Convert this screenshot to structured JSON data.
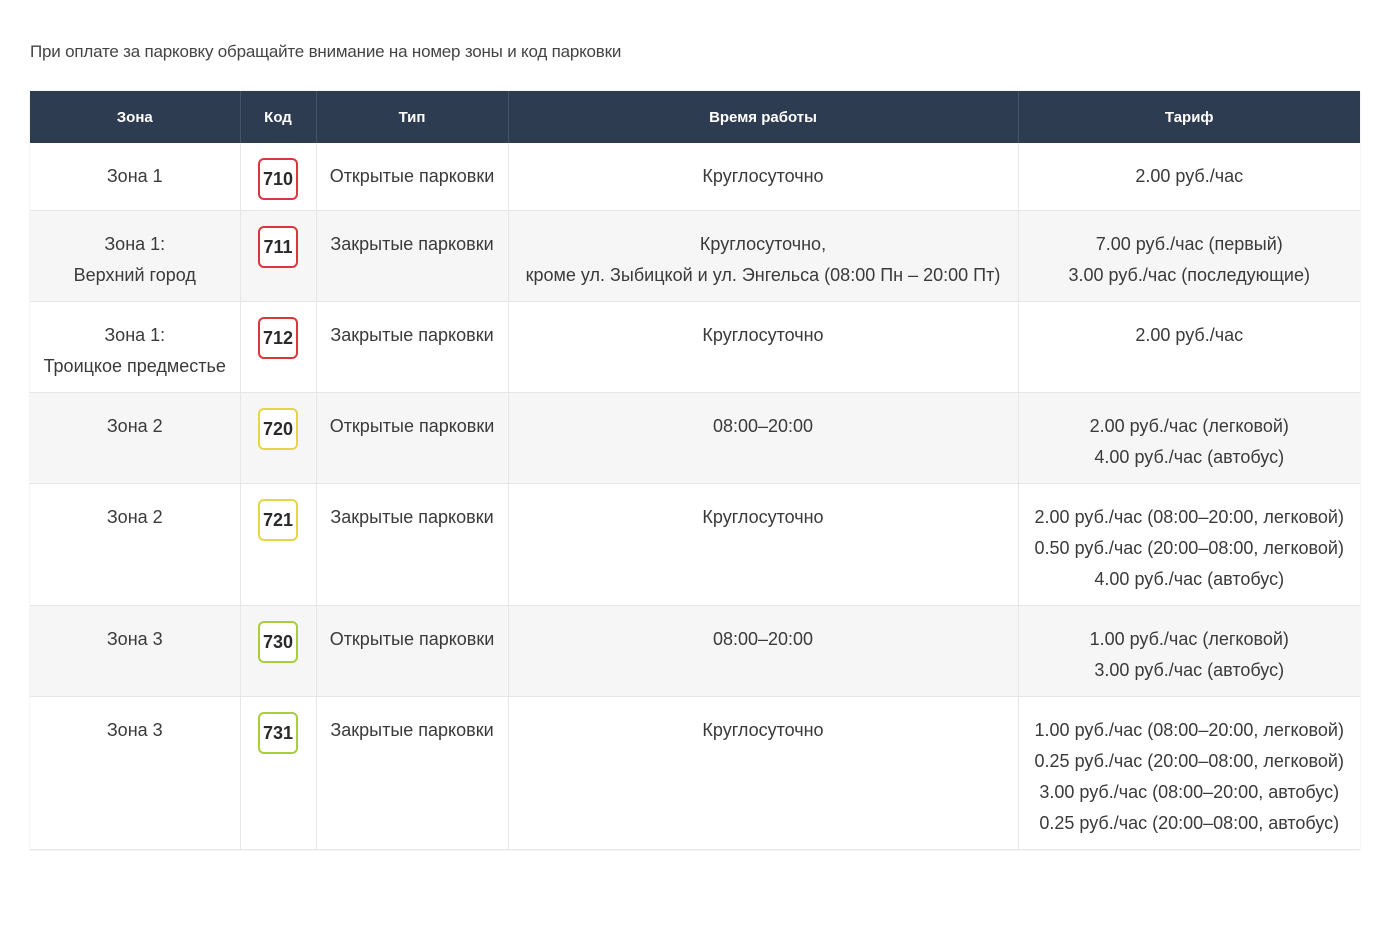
{
  "note": "При оплате за парковку обращайте внимание на номер зоны и код парковки",
  "table": {
    "headers": [
      "Зона",
      "Код",
      "Тип",
      "Время работы",
      "Тариф"
    ],
    "rows": [
      {
        "zone": [
          "Зона 1"
        ],
        "code": "710",
        "code_color": "red",
        "type": "Открытые парковки",
        "hours": [
          "Круглосуточно"
        ],
        "tariff": [
          "2.00 руб./час"
        ]
      },
      {
        "zone": [
          "Зона 1:",
          "Верхний город"
        ],
        "code": "711",
        "code_color": "red",
        "type": "Закрытые парковки",
        "hours": [
          "Круглосуточно,",
          "кроме ул. Зыбицкой и ул. Энгельса (08:00 Пн – 20:00 Пт)"
        ],
        "tariff": [
          "7.00 руб./час (первый)",
          "3.00 руб./час (последующие)"
        ]
      },
      {
        "zone": [
          "Зона 1:",
          "Троицкое предместье"
        ],
        "code": "712",
        "code_color": "red",
        "type": "Закрытые парковки",
        "hours": [
          "Круглосуточно"
        ],
        "tariff": [
          "2.00 руб./час"
        ]
      },
      {
        "zone": [
          "Зона 2"
        ],
        "code": "720",
        "code_color": "yellow",
        "type": "Открытые парковки",
        "hours": [
          "08:00–20:00"
        ],
        "tariff": [
          "2.00 руб./час (легковой)",
          "4.00 руб./час (автобус)"
        ]
      },
      {
        "zone": [
          "Зона 2"
        ],
        "code": "721",
        "code_color": "yellow",
        "type": "Закрытые парковки",
        "hours": [
          "Круглосуточно"
        ],
        "tariff": [
          "2.00 руб./час (08:00–20:00, легковой)",
          "0.50 руб./час (20:00–08:00, легковой)",
          "4.00 руб./час (автобус)"
        ]
      },
      {
        "zone": [
          "Зона 3"
        ],
        "code": "730",
        "code_color": "green",
        "type": "Открытые парковки",
        "hours": [
          "08:00–20:00"
        ],
        "tariff": [
          "1.00 руб./час (легковой)",
          "3.00 руб./час (автобус)"
        ]
      },
      {
        "zone": [
          "Зона 3"
        ],
        "code": "731",
        "code_color": "green",
        "type": "Закрытые парковки",
        "hours": [
          "Круглосуточно"
        ],
        "tariff": [
          "1.00 руб./час (08:00–20:00, легковой)",
          "0.25 руб./час (20:00–08:00, легковой)",
          "3.00 руб./час (08:00–20:00, автобус)",
          "0.25 руб./час (20:00–08:00, автобус)"
        ]
      }
    ]
  },
  "colors": {
    "header_bg": "#2e3c52",
    "badge_red": "#d9363e",
    "badge_yellow": "#e4d644",
    "badge_green": "#a6cf3b"
  }
}
